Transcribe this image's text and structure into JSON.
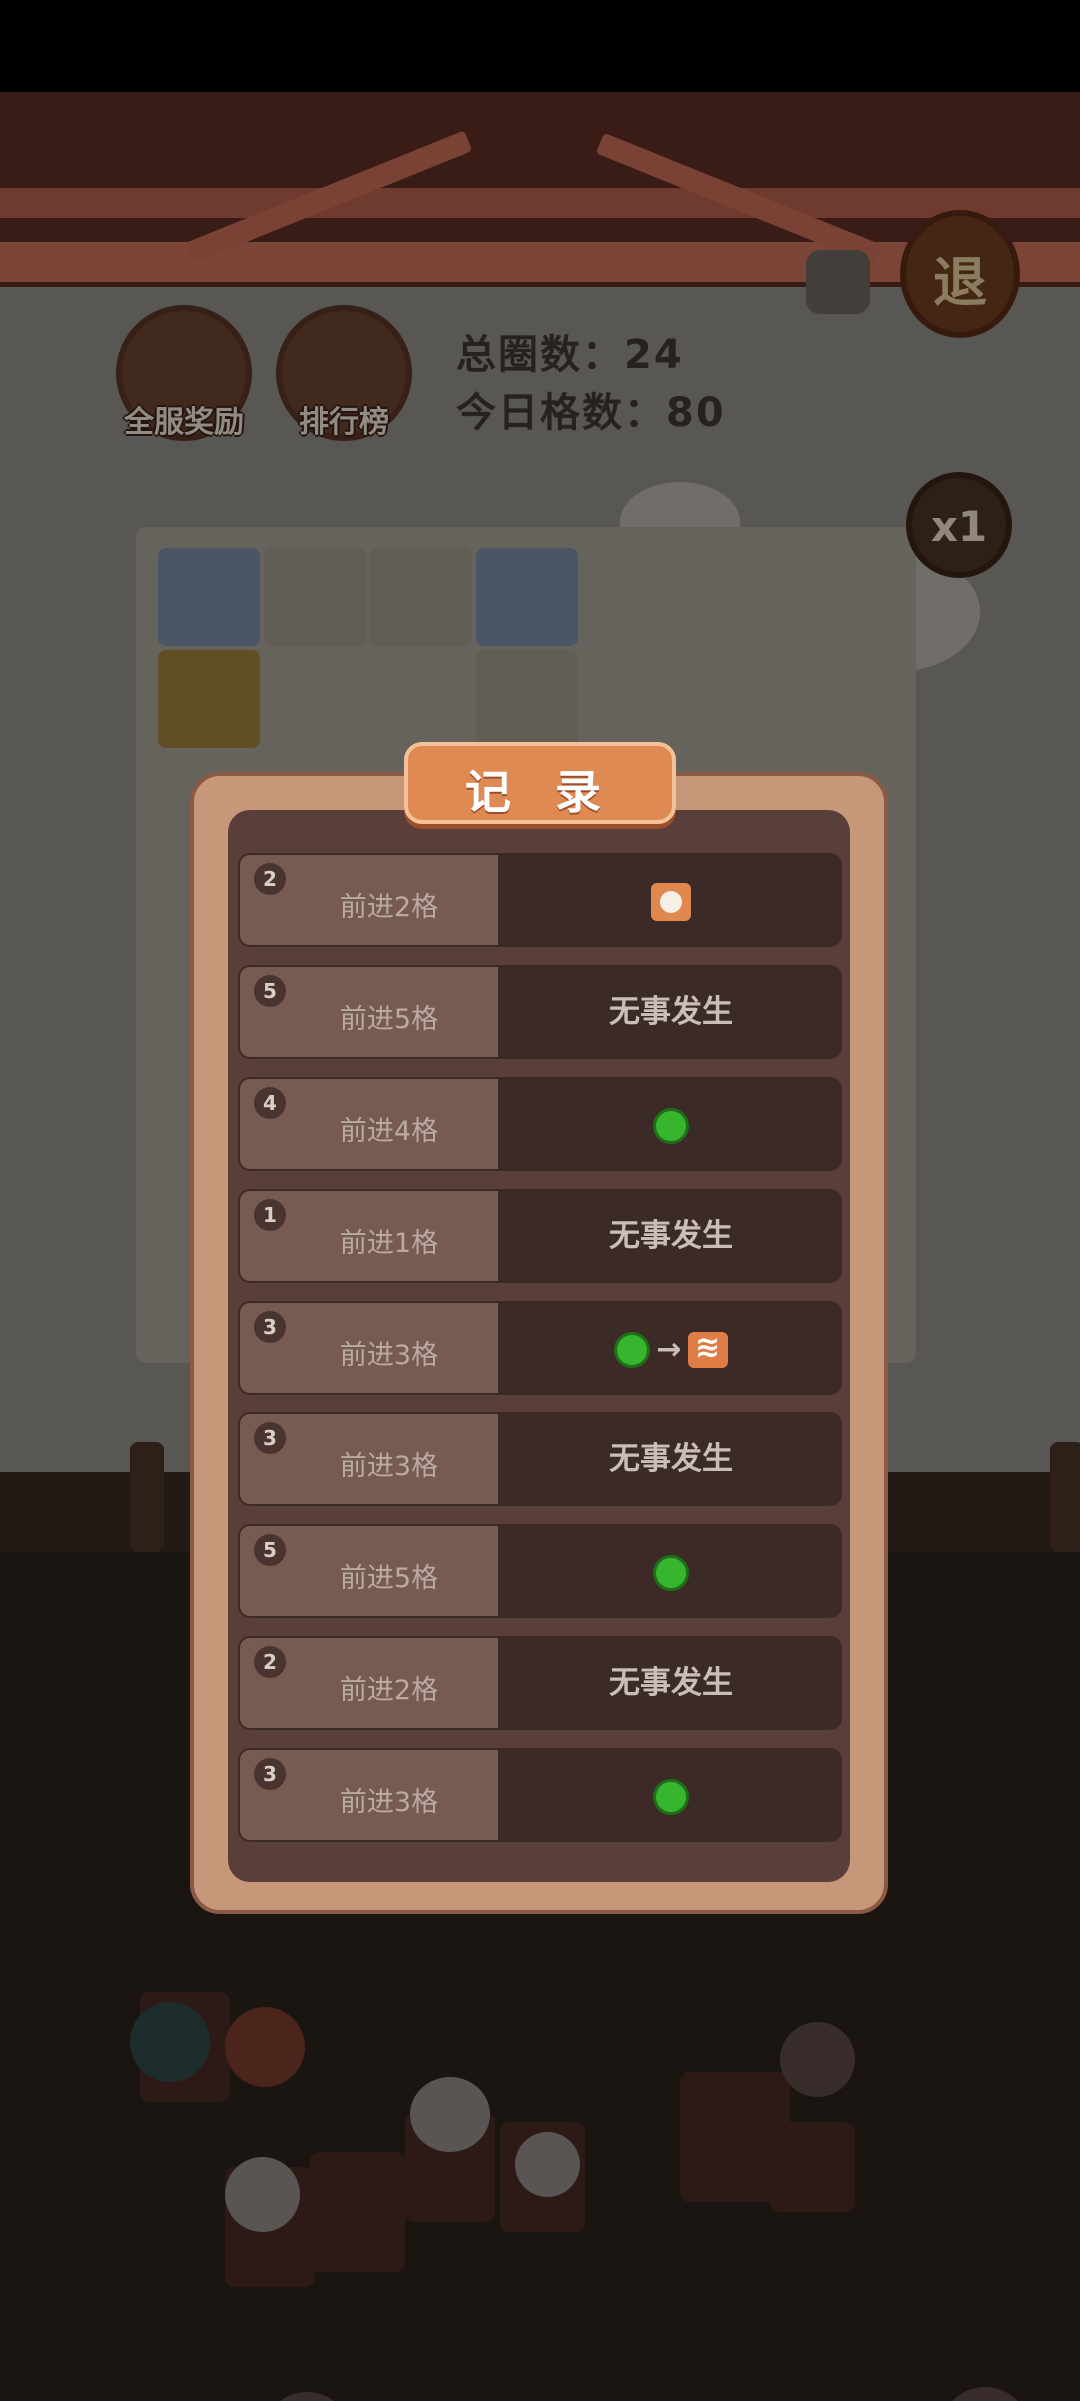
{
  "top_buttons": {
    "server_rewards_label": "全服奖励",
    "leaderboard_label": "排行榜",
    "exit_label": "退",
    "speed_label": "x1"
  },
  "stats": {
    "total_laps": "总圈数：24",
    "today_cells": "今日格数：80"
  },
  "dialog": {
    "title": "记 录",
    "records": [
      {
        "dice": "2",
        "move": "前进2格",
        "result": "",
        "icons": [
          "bun-icon"
        ]
      },
      {
        "dice": "5",
        "move": "前进5格",
        "result": "无事发生",
        "icons": []
      },
      {
        "dice": "4",
        "move": "前进4格",
        "result": "",
        "icons": [
          "green-bean-icon"
        ]
      },
      {
        "dice": "1",
        "move": "前进1格",
        "result": "无事发生",
        "icons": []
      },
      {
        "dice": "3",
        "move": "前进3格",
        "result": "",
        "icons": [
          "green-bean-icon",
          "arrow-icon",
          "wave-tile-icon"
        ]
      },
      {
        "dice": "3",
        "move": "前进3格",
        "result": "无事发生",
        "icons": []
      },
      {
        "dice": "5",
        "move": "前进5格",
        "result": "",
        "icons": [
          "green-bean-icon"
        ]
      },
      {
        "dice": "2",
        "move": "前进2格",
        "result": "无事发生",
        "icons": []
      },
      {
        "dice": "3",
        "move": "前进3格",
        "result": "",
        "icons": [
          "green-bean-icon"
        ]
      }
    ]
  },
  "colors": {
    "dialog_frame": "#c7977a",
    "dialog_inner": "#5a3e3a",
    "title_plate": "#e08a53",
    "row_left": "#775a50",
    "row_right": "#3c2a27",
    "bean_green": "#37b52e"
  }
}
